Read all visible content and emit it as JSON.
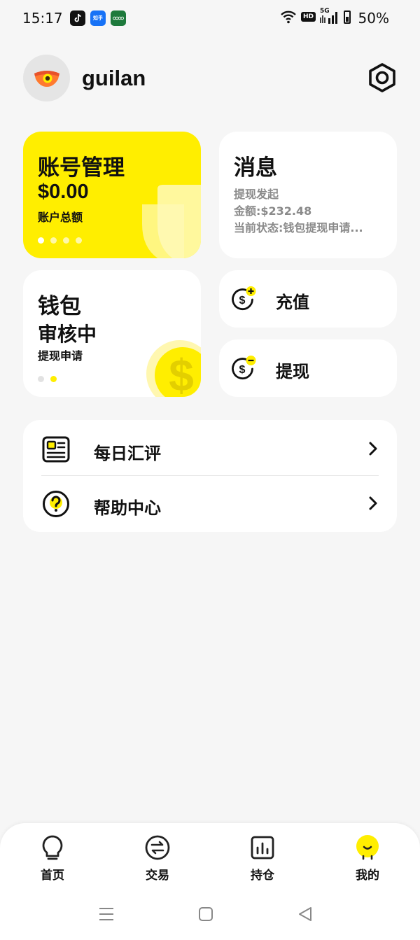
{
  "status_bar": {
    "time": "15:17",
    "apps": [
      "tiktok-icon",
      "zhihu-icon",
      "oppo-icon"
    ],
    "zhihu_text": "知乎",
    "hd": "HD",
    "network": "5G",
    "battery": "50%"
  },
  "profile": {
    "username": "guilan"
  },
  "account_card": {
    "title": "账号管理",
    "amount": "$0.00",
    "label": "账户总额",
    "pager_active": 0,
    "pager_count": 4
  },
  "message_card": {
    "title": "消息",
    "line1": "提现发起",
    "line2": "金额:$232.48",
    "line3": "当前状态:钱包提现申请..."
  },
  "wallet_card": {
    "title": "钱包",
    "status": "审核中",
    "label": "提现申请",
    "pager_active": 1,
    "pager_count": 2
  },
  "actions": {
    "recharge": "充值",
    "withdraw": "提现"
  },
  "list": [
    {
      "label": "每日汇评",
      "icon": "newspaper-icon"
    },
    {
      "label": "帮助中心",
      "icon": "help-icon"
    }
  ],
  "bottom_nav": [
    {
      "label": "首页",
      "icon": "lightbulb-icon"
    },
    {
      "label": "交易",
      "icon": "exchange-icon"
    },
    {
      "label": "持仓",
      "icon": "chart-icon"
    },
    {
      "label": "我的",
      "icon": "profile-icon",
      "active": true
    }
  ],
  "colors": {
    "accent": "#ffee00",
    "background": "#f6f6f6",
    "muted_text": "#8a8a8a"
  }
}
